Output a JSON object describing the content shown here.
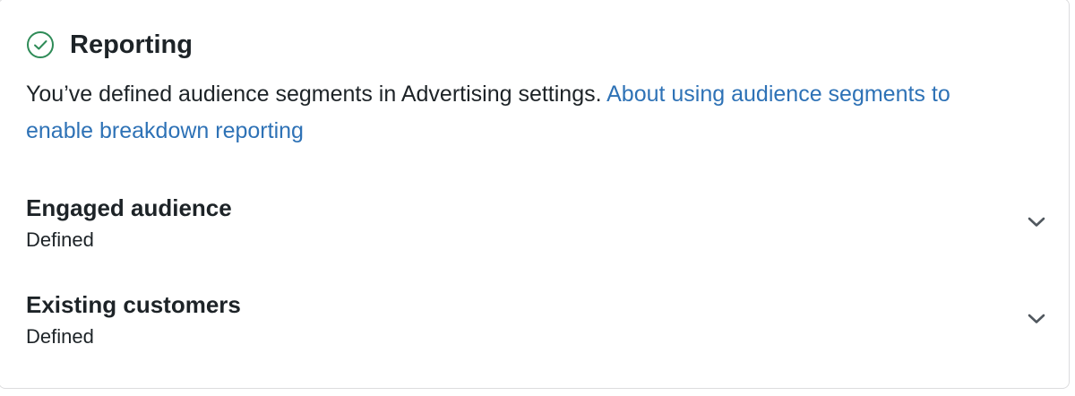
{
  "section": {
    "title": "Reporting",
    "status_icon": "check-circle-icon",
    "description_text": "You’ve defined audience segments in Advertising settings. ",
    "link_text": "About using audience segments to enable breakdown reporting"
  },
  "segments": [
    {
      "name": "Engaged audience",
      "status": "Defined",
      "icon": "chevron-down-icon"
    },
    {
      "name": "Existing customers",
      "status": "Defined",
      "icon": "chevron-down-icon"
    }
  ],
  "colors": {
    "success": "#2e8b57",
    "link": "#2e72b6",
    "text": "#1d2327",
    "chevron": "#50575e"
  }
}
